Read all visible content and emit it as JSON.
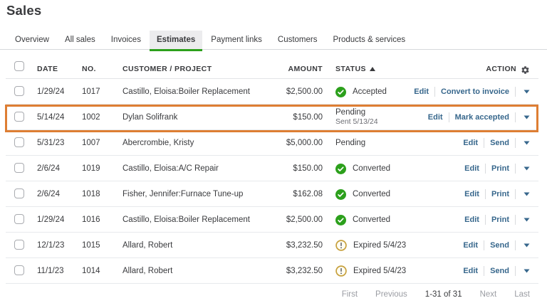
{
  "page": {
    "title": "Sales"
  },
  "tabs": [
    {
      "label": "Overview",
      "active": false
    },
    {
      "label": "All sales",
      "active": false
    },
    {
      "label": "Invoices",
      "active": false
    },
    {
      "label": "Estimates",
      "active": true
    },
    {
      "label": "Payment links",
      "active": false
    },
    {
      "label": "Customers",
      "active": false
    },
    {
      "label": "Products & services",
      "active": false
    }
  ],
  "table": {
    "headers": {
      "date": "DATE",
      "no": "NO.",
      "customer": "CUSTOMER / PROJECT",
      "amount": "AMOUNT",
      "status": "STATUS",
      "action": "ACTION"
    },
    "rows": [
      {
        "date": "1/29/24",
        "no": "1017",
        "customer": "Castillo, Eloisa:Boiler Replacement",
        "amount": "$2,500.00",
        "status": "Accepted",
        "status_icon": "success",
        "status_sub": "",
        "actions": [
          "Edit",
          "Convert to invoice"
        ],
        "selected": false
      },
      {
        "date": "5/14/24",
        "no": "1002",
        "customer": "Dylan Solifrank",
        "amount": "$150.00",
        "status": "Pending",
        "status_icon": "none",
        "status_sub": "Sent 5/13/24",
        "actions": [
          "Edit",
          "Mark accepted"
        ],
        "selected": true
      },
      {
        "date": "5/31/23",
        "no": "1007",
        "customer": "Abercrombie, Kristy",
        "amount": "$5,000.00",
        "status": "Pending",
        "status_icon": "none",
        "status_sub": "",
        "actions": [
          "Edit",
          "Send"
        ],
        "selected": false
      },
      {
        "date": "2/6/24",
        "no": "1019",
        "customer": "Castillo, Eloisa:A/C Repair",
        "amount": "$150.00",
        "status": "Converted",
        "status_icon": "success",
        "status_sub": "",
        "actions": [
          "Edit",
          "Print"
        ],
        "selected": false
      },
      {
        "date": "2/6/24",
        "no": "1018",
        "customer": "Fisher, Jennifer:Furnace Tune-up",
        "amount": "$162.08",
        "status": "Converted",
        "status_icon": "success",
        "status_sub": "",
        "actions": [
          "Edit",
          "Print"
        ],
        "selected": false
      },
      {
        "date": "1/29/24",
        "no": "1016",
        "customer": "Castillo, Eloisa:Boiler Replacement",
        "amount": "$2,500.00",
        "status": "Converted",
        "status_icon": "success",
        "status_sub": "",
        "actions": [
          "Edit",
          "Print"
        ],
        "selected": false
      },
      {
        "date": "12/1/23",
        "no": "1015",
        "customer": "Allard, Robert",
        "amount": "$3,232.50",
        "status": "Expired 5/4/23",
        "status_icon": "warning",
        "status_sub": "",
        "actions": [
          "Edit",
          "Send"
        ],
        "selected": false
      },
      {
        "date": "11/1/23",
        "no": "1014",
        "customer": "Allard, Robert",
        "amount": "$3,232.50",
        "status": "Expired 5/4/23",
        "status_icon": "warning",
        "status_sub": "",
        "actions": [
          "Edit",
          "Send"
        ],
        "selected": false
      }
    ]
  },
  "pagination": {
    "first": "First",
    "previous": "Previous",
    "range": "1-31 of 31",
    "next": "Next",
    "last": "Last"
  },
  "colors": {
    "brand_green": "#2ca01c",
    "link_blue": "#37678c",
    "selected_orange": "#de7e33",
    "warning_gold": "#c7a03c"
  }
}
